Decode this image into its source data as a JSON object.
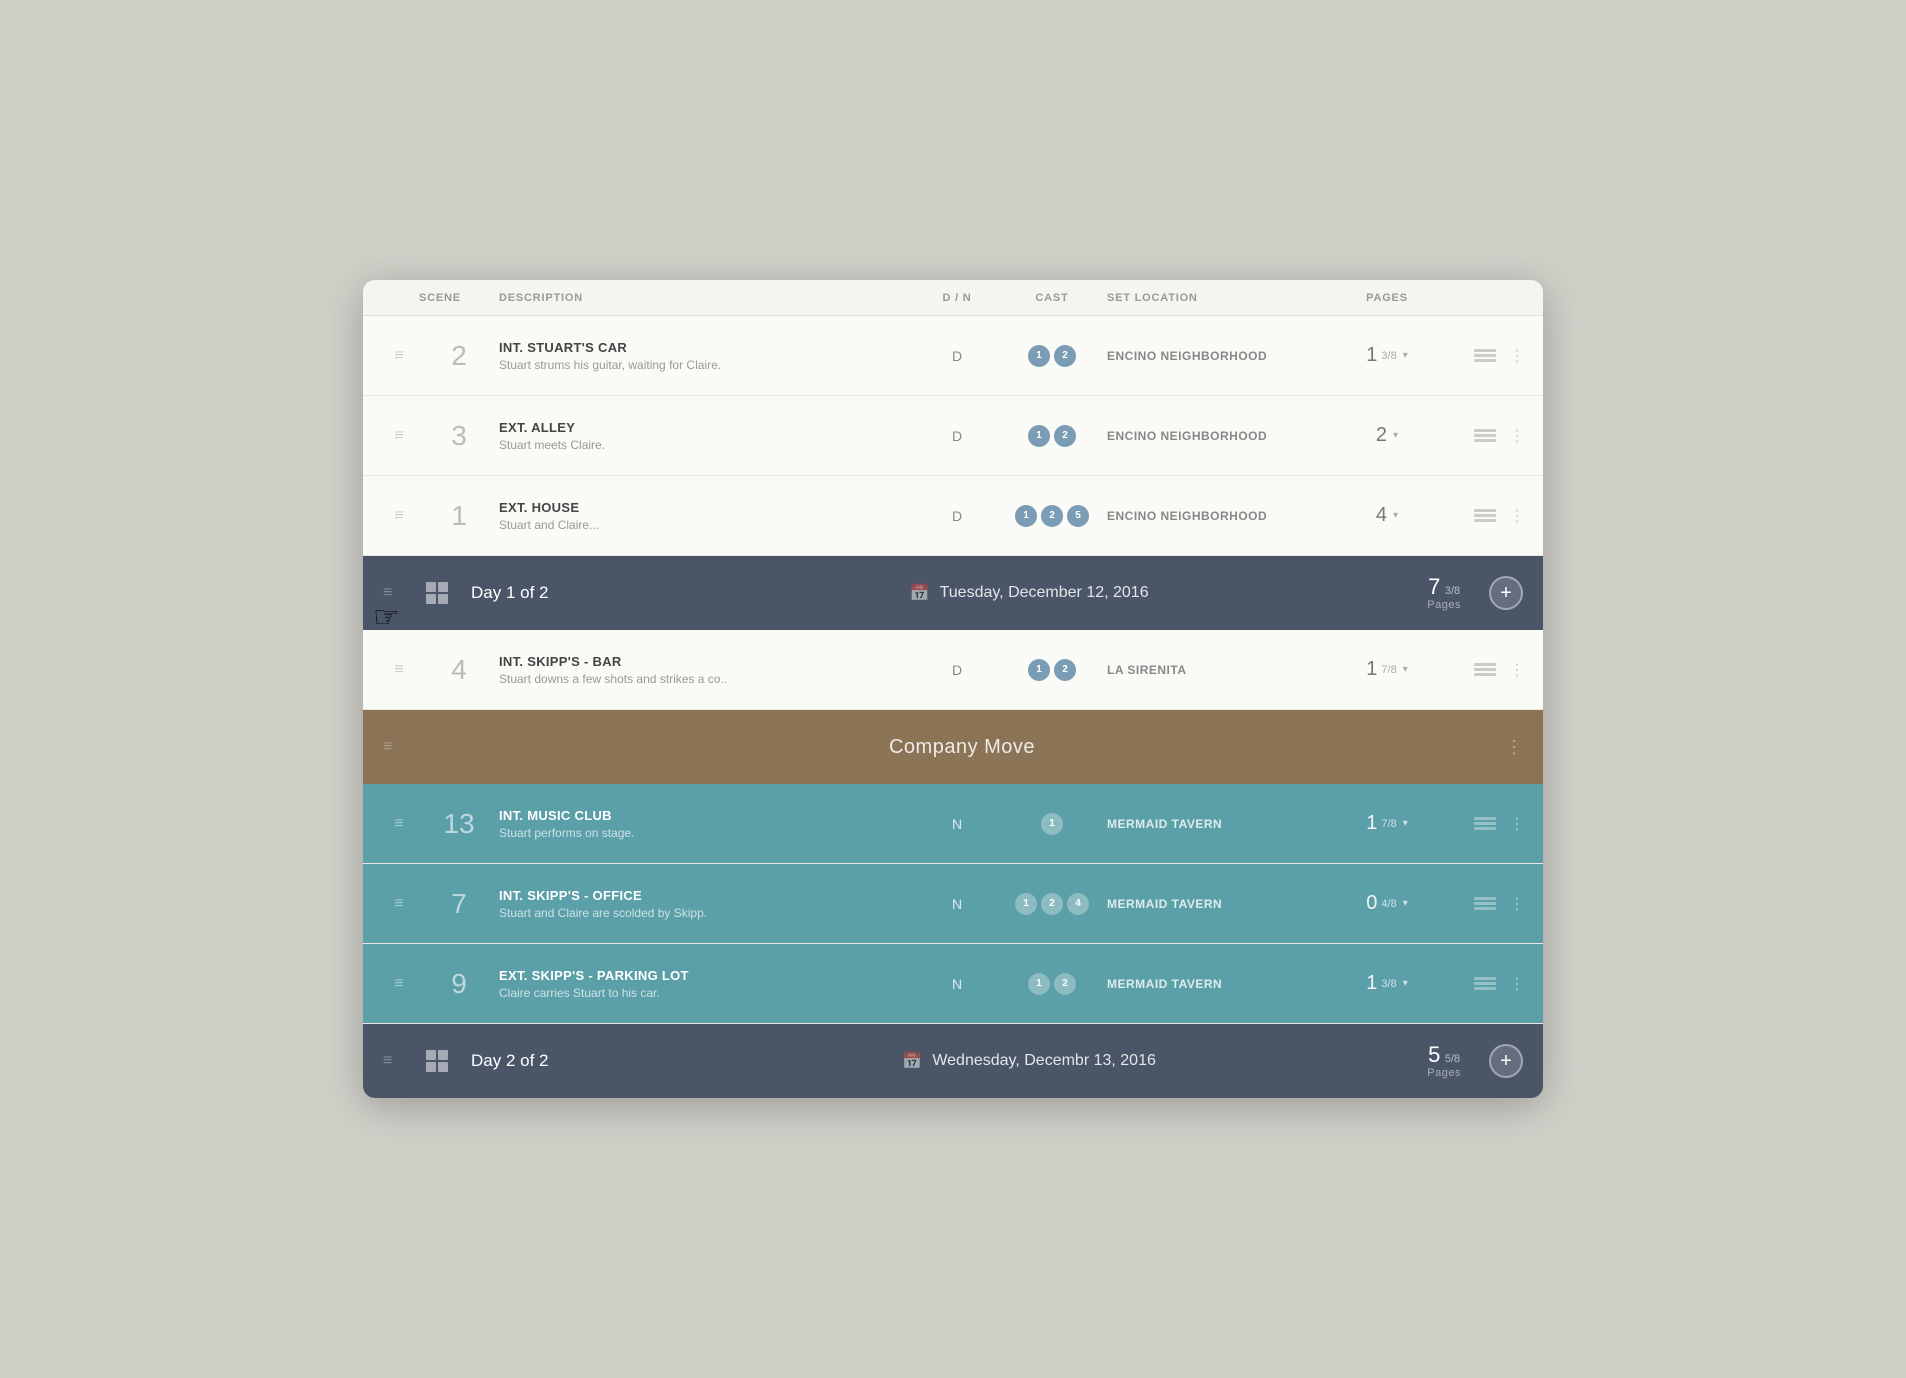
{
  "columns": {
    "scene": "SCENE",
    "description": "DESCRIPTION",
    "dm": "D / N",
    "cast": "CAST",
    "set_location": "SET LOCATION",
    "pages": "PAGES"
  },
  "rows": [
    {
      "id": "row-2",
      "scene_number": "2",
      "title": "INT. STUART'S CAR",
      "description": "Stuart strums his guitar, waiting for Claire.",
      "dm": "D",
      "cast": [
        "1",
        "2"
      ],
      "location": "ENCINO NEIGHBORHOOD",
      "pages_main": "1",
      "pages_frac": "3/8",
      "teal": false
    },
    {
      "id": "row-3",
      "scene_number": "3",
      "title": "EXT. ALLEY",
      "description": "Stuart meets Claire.",
      "dm": "D",
      "cast": [
        "1",
        "2"
      ],
      "location": "ENCINO NEIGHBORHOOD",
      "pages_main": "2",
      "pages_frac": "",
      "teal": false
    },
    {
      "id": "row-1",
      "scene_number": "1",
      "title": "EXT. HOUSE",
      "description": "Stuart and Claire...",
      "dm": "D",
      "cast": [
        "1",
        "2",
        "5"
      ],
      "location": "ENCINO NEIGHBORHOOD",
      "pages_main": "4",
      "pages_frac": "",
      "teal": false,
      "partial": true
    }
  ],
  "day1": {
    "label": "Day 1 of 2",
    "date": "Tuesday, December 12, 2016",
    "pages_main": "7",
    "pages_frac": "3/8",
    "pages_label": "Pages"
  },
  "rows_day1_after": [
    {
      "id": "row-4",
      "scene_number": "4",
      "title": "INT. SKIPP'S - BAR",
      "description": "Stuart downs a few shots and strikes a co..",
      "dm": "D",
      "cast": [
        "1",
        "2"
      ],
      "location": "LA SIRENITA",
      "pages_main": "1",
      "pages_frac": "7/8",
      "teal": false
    }
  ],
  "company_move": {
    "label": "Company Move"
  },
  "rows_day2": [
    {
      "id": "row-13",
      "scene_number": "13",
      "title": "INT. MUSIC CLUB",
      "description": "Stuart performs on stage.",
      "dm": "N",
      "cast": [
        "1"
      ],
      "location": "MERMAID TAVERN",
      "pages_main": "1",
      "pages_frac": "7/8",
      "teal": true
    },
    {
      "id": "row-7",
      "scene_number": "7",
      "title": "INT. SKIPP'S - OFFICE",
      "description": "Stuart and Claire are scolded by Skipp.",
      "dm": "N",
      "cast": [
        "1",
        "2",
        "4"
      ],
      "location": "MERMAID TAVERN",
      "pages_main": "0",
      "pages_frac": "4/8",
      "teal": true
    },
    {
      "id": "row-9",
      "scene_number": "9",
      "title": "EXT. SKIPP'S - PARKING LOT",
      "description": "Claire carries Stuart to his car.",
      "dm": "N",
      "cast": [
        "1",
        "2"
      ],
      "location": "MERMAID TAVERN",
      "pages_main": "1",
      "pages_frac": "3/8",
      "teal": true
    }
  ],
  "day2": {
    "label": "Day 2 of 2",
    "date": "Wednesday, Decembr 13, 2016",
    "pages_main": "5",
    "pages_frac": "5/8",
    "pages_label": "Pages"
  },
  "cursor": "☞"
}
